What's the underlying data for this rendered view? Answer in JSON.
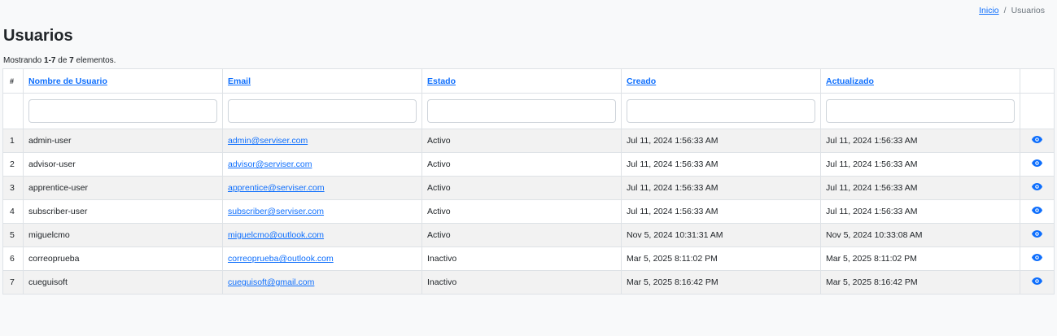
{
  "breadcrumb": {
    "home_label": "Inicio",
    "separator": "/",
    "current": "Usuarios"
  },
  "page": {
    "title": "Usuarios",
    "summary_prefix": "Mostrando",
    "summary_range": "1-7",
    "summary_of": "de",
    "summary_total": "7",
    "summary_suffix": "elementos."
  },
  "table": {
    "headers": {
      "index": "#",
      "username": "Nombre de Usuario",
      "email": "Email",
      "status": "Estado",
      "created": "Creado",
      "updated": "Actualizado"
    },
    "rows": [
      {
        "index": "1",
        "username": "admin-user",
        "email": "admin@serviser.com",
        "status": "Activo",
        "created": "Jul 11, 2024 1:56:33 AM",
        "updated": "Jul 11, 2024 1:56:33 AM"
      },
      {
        "index": "2",
        "username": "advisor-user",
        "email": "advisor@serviser.com",
        "status": "Activo",
        "created": "Jul 11, 2024 1:56:33 AM",
        "updated": "Jul 11, 2024 1:56:33 AM"
      },
      {
        "index": "3",
        "username": "apprentice-user",
        "email": "apprentice@serviser.com",
        "status": "Activo",
        "created": "Jul 11, 2024 1:56:33 AM",
        "updated": "Jul 11, 2024 1:56:33 AM"
      },
      {
        "index": "4",
        "username": "subscriber-user",
        "email": "subscriber@serviser.com",
        "status": "Activo",
        "created": "Jul 11, 2024 1:56:33 AM",
        "updated": "Jul 11, 2024 1:56:33 AM"
      },
      {
        "index": "5",
        "username": "miguelcmo",
        "email": "miguelcmo@outlook.com",
        "status": "Activo",
        "created": "Nov 5, 2024 10:31:31 AM",
        "updated": "Nov 5, 2024 10:33:08 AM"
      },
      {
        "index": "6",
        "username": "correoprueba",
        "email": "correoprueba@outlook.com",
        "status": "Inactivo",
        "created": "Mar 5, 2025 8:11:02 PM",
        "updated": "Mar 5, 2025 8:11:02 PM"
      },
      {
        "index": "7",
        "username": "cueguisoft",
        "email": "cueguisoft@gmail.com",
        "status": "Inactivo",
        "created": "Mar 5, 2025 8:16:42 PM",
        "updated": "Mar 5, 2025 8:16:42 PM"
      }
    ],
    "row_action_icon": "eye-icon"
  },
  "colors": {
    "link": "#0d6efd",
    "stripe": "#f2f2f2",
    "border": "#dee2e6",
    "background": "#f8f9fa"
  }
}
